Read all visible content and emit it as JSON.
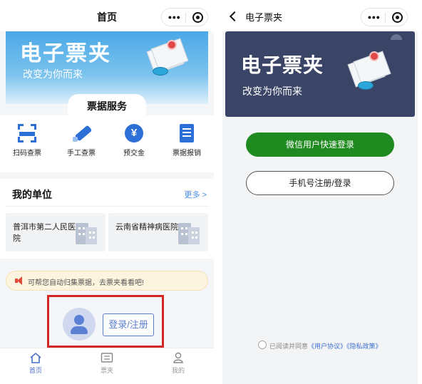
{
  "left": {
    "title": "首页",
    "banner": {
      "title": "电子票夹",
      "subtitle": "改变为你而来"
    },
    "services_title": "票据服务",
    "services": [
      {
        "label": "扫码查票",
        "icon": "scan-icon"
      },
      {
        "label": "手工查票",
        "icon": "pen-icon"
      },
      {
        "label": "预交金",
        "icon": "yen-icon"
      },
      {
        "label": "票据报销",
        "icon": "document-icon"
      }
    ],
    "units": {
      "title": "我的单位",
      "more": "更多 >",
      "items": [
        {
          "name": "普洱市第二人民医院"
        },
        {
          "name": "云南省精神病医院"
        }
      ]
    },
    "notice": "可帮您自动归集票据，去票夹看看吧!",
    "login_button": "登录/注册",
    "tabs": [
      {
        "label": "首页",
        "icon": "home-icon",
        "active": true
      },
      {
        "label": "票夹",
        "icon": "ticket-icon",
        "active": false
      },
      {
        "label": "我的",
        "icon": "person-icon",
        "active": false
      }
    ]
  },
  "right": {
    "title": "电子票夹",
    "banner": {
      "title": "电子票夹",
      "subtitle": "改变为你而来"
    },
    "wechat_login": "微信用户快速登录",
    "phone_login": "手机号注册/登录",
    "agreement": {
      "prefix": "已阅读并同意",
      "user_agreement": "《用户协议》",
      "privacy_policy": "《隐私政策》"
    }
  },
  "colors": {
    "accent_blue": "#2c6fd6",
    "wechat_green": "#1f8a1f",
    "highlight_red": "#d42525",
    "dark_banner": "#3a4466"
  }
}
